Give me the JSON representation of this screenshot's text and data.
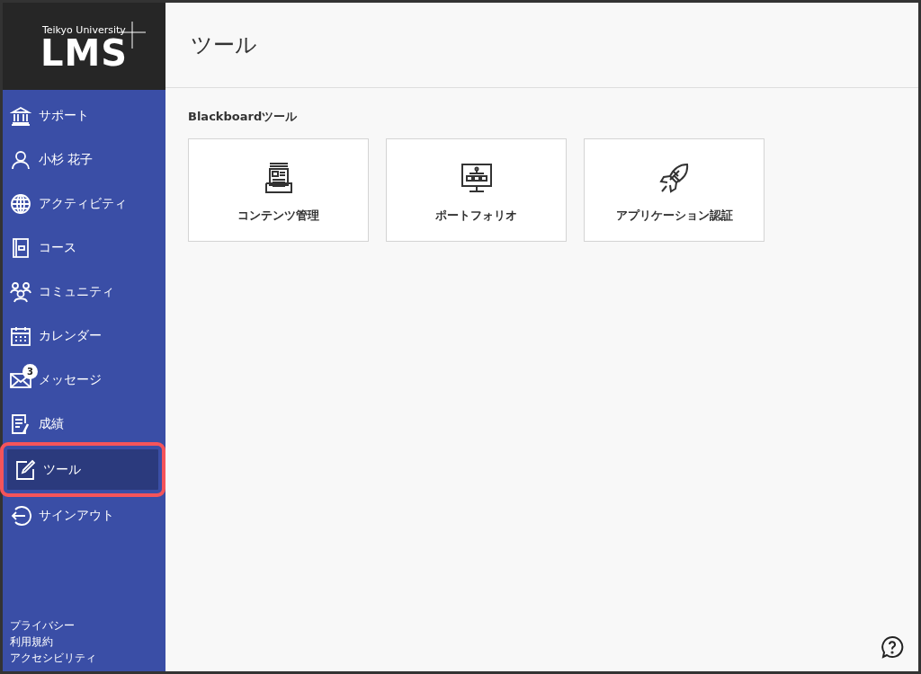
{
  "logo": {
    "subtitle": "Teikyo University",
    "title": "LMS"
  },
  "sidebar": {
    "items": [
      {
        "kind": "support",
        "label": "サポート",
        "selected": false,
        "highlighted": false
      },
      {
        "kind": "person",
        "label": "小杉 花子",
        "selected": false,
        "highlighted": false
      },
      {
        "kind": "globe",
        "label": "アクティビティ",
        "selected": false,
        "highlighted": false
      },
      {
        "kind": "course",
        "label": "コース",
        "selected": false,
        "highlighted": false
      },
      {
        "kind": "community",
        "label": "コミュニティ",
        "selected": false,
        "highlighted": false
      },
      {
        "kind": "calendar",
        "label": "カレンダー",
        "selected": false,
        "highlighted": false
      },
      {
        "kind": "mail",
        "label": "メッセージ",
        "badge": "3",
        "selected": false,
        "highlighted": false
      },
      {
        "kind": "grades",
        "label": "成績",
        "selected": false,
        "highlighted": false
      },
      {
        "kind": "tools",
        "label": "ツール",
        "selected": true,
        "highlighted": true
      },
      {
        "kind": "signout",
        "label": "サインアウト",
        "selected": false,
        "highlighted": false
      }
    ],
    "footer_links": [
      "プライバシー",
      "利用規約",
      "アクセシビリティ"
    ]
  },
  "page": {
    "title": "ツール",
    "section_title": "Blackboardツール",
    "tools": [
      {
        "kind": "content",
        "label": "コンテンツ管理"
      },
      {
        "kind": "portfolio",
        "label": "ポートフォリオ"
      },
      {
        "kind": "rocket",
        "label": "アプリケーション認証"
      }
    ]
  }
}
